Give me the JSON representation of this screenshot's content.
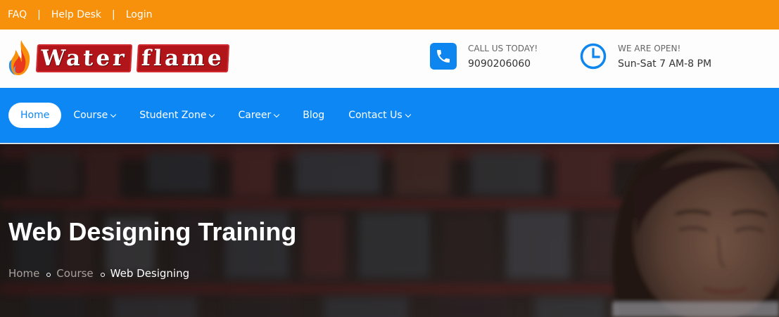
{
  "topbar": {
    "links": [
      "FAQ",
      "Help Desk",
      "Login"
    ],
    "separator": "|"
  },
  "header": {
    "logo_words": [
      "Water",
      "flame"
    ],
    "contacts": [
      {
        "label": "CALL US TODAY!",
        "value": "9090206060",
        "icon": "phone-icon"
      },
      {
        "label": "WE ARE OPEN!",
        "value": "Sun-Sat 7 AM-8 PM",
        "icon": "clock-icon"
      }
    ]
  },
  "nav": {
    "items": [
      {
        "label": "Home",
        "active": true,
        "dropdown": false
      },
      {
        "label": "Course",
        "active": false,
        "dropdown": true
      },
      {
        "label": "Student Zone",
        "active": false,
        "dropdown": true
      },
      {
        "label": "Career",
        "active": false,
        "dropdown": true
      },
      {
        "label": "Blog",
        "active": false,
        "dropdown": false
      },
      {
        "label": "Contact Us",
        "active": false,
        "dropdown": true
      }
    ]
  },
  "hero": {
    "title": "Web Designing Training",
    "breadcrumb": [
      "Home",
      "Course",
      "Web Designing"
    ]
  },
  "colors": {
    "topbar": "#f7900a",
    "nav": "#0c87f3",
    "accent": "#0d86f0",
    "logo_red": "#b1151a"
  }
}
